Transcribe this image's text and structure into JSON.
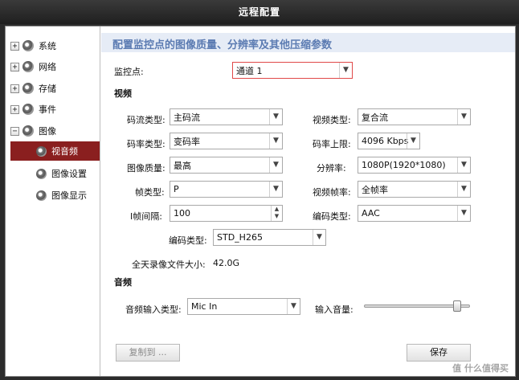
{
  "window": {
    "title": "远程配置"
  },
  "sidebar": {
    "items": [
      {
        "label": "系统",
        "expander": "+"
      },
      {
        "label": "网络",
        "expander": "+"
      },
      {
        "label": "存储",
        "expander": "+"
      },
      {
        "label": "事件",
        "expander": "+"
      },
      {
        "label": "图像",
        "expander": "−"
      }
    ],
    "subitems": [
      {
        "label": "视音频"
      },
      {
        "label": "图像设置"
      },
      {
        "label": "图像显示"
      }
    ]
  },
  "main": {
    "header": "配置监控点的图像质量、分辨率及其他压缩参数",
    "monitor_point": {
      "label": "监控点:",
      "value": "通道 1"
    },
    "video_section": "视频",
    "stream_type": {
      "label": "码流类型:",
      "value": "主码流"
    },
    "video_type": {
      "label": "视频类型:",
      "value": "复合流"
    },
    "bitrate_type": {
      "label": "码率类型:",
      "value": "变码率"
    },
    "bitrate_limit": {
      "label": "码率上限:",
      "value": "4096 Kbps"
    },
    "image_quality": {
      "label": "图像质量:",
      "value": "最高"
    },
    "resolution": {
      "label": "分辨率:",
      "value": "1080P(1920*1080)"
    },
    "frame_type": {
      "label": "帧类型:",
      "value": "P"
    },
    "frame_rate": {
      "label": "视频帧率:",
      "value": "全帧率"
    },
    "i_frame_interval": {
      "label": "I帧间隔:",
      "value": "100"
    },
    "audio_codec": {
      "label": "编码类型:",
      "value": "AAC"
    },
    "video_codec": {
      "label": "编码类型:",
      "value": "STD_H265"
    },
    "file_size": {
      "label": "全天录像文件大小:",
      "value": "42.0G"
    },
    "audio_section": "音频",
    "audio_input": {
      "label": "音频输入类型:",
      "value": "Mic In"
    },
    "input_volume": {
      "label": "输入音量:",
      "level": 0.88
    },
    "copy_button": "复制到 ...",
    "save_button": "保存"
  },
  "watermark": "值 什么值得买",
  "colors": {
    "accent": "#8a1f1f",
    "header_text": "#5b7bb2",
    "header_bg": "#e6ecf6"
  }
}
